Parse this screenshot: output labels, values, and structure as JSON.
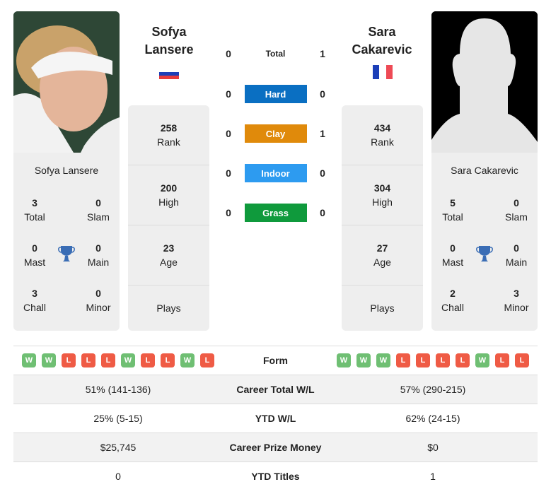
{
  "player1": {
    "name_line1": "Sofya",
    "name_line2": "Lansere",
    "full_name": "Sofya Lansere",
    "flag": "russia-flag",
    "titles": {
      "total": "3",
      "total_label": "Total",
      "slam": "0",
      "slam_label": "Slam",
      "mast": "0",
      "mast_label": "Mast",
      "main": "0",
      "main_label": "Main",
      "chall": "3",
      "chall_label": "Chall",
      "minor": "0",
      "minor_label": "Minor"
    },
    "stats": {
      "rank": "258",
      "rank_label": "Rank",
      "high": "200",
      "high_label": "High",
      "age": "23",
      "age_label": "Age",
      "plays_label": "Plays"
    },
    "form": [
      "W",
      "W",
      "L",
      "L",
      "L",
      "W",
      "L",
      "L",
      "W",
      "L"
    ],
    "career_wl": "51% (141-136)",
    "ytd_wl": "25% (5-15)",
    "prize_money": "$25,745",
    "ytd_titles": "0"
  },
  "player2": {
    "name_line1": "Sara",
    "name_line2": "Cakarevic",
    "full_name": "Sara Cakarevic",
    "flag": "france-flag",
    "titles": {
      "total": "5",
      "total_label": "Total",
      "slam": "0",
      "slam_label": "Slam",
      "mast": "0",
      "mast_label": "Mast",
      "main": "0",
      "main_label": "Main",
      "chall": "2",
      "chall_label": "Chall",
      "minor": "3",
      "minor_label": "Minor"
    },
    "stats": {
      "rank": "434",
      "rank_label": "Rank",
      "high": "304",
      "high_label": "High",
      "age": "27",
      "age_label": "Age",
      "plays_label": "Plays"
    },
    "form": [
      "W",
      "W",
      "W",
      "L",
      "L",
      "L",
      "L",
      "W",
      "L",
      "L"
    ],
    "career_wl": "57% (290-215)",
    "ytd_wl": "62% (24-15)",
    "prize_money": "$0",
    "ytd_titles": "1"
  },
  "h2h": {
    "total": {
      "label": "Total",
      "p1": "0",
      "p2": "1"
    },
    "surfaces": [
      {
        "label": "Hard",
        "p1": "0",
        "p2": "0",
        "color": "#0a6fc2"
      },
      {
        "label": "Clay",
        "p1": "0",
        "p2": "1",
        "color": "#e08a0b"
      },
      {
        "label": "Indoor",
        "p1": "0",
        "p2": "0",
        "color": "#2d9bf0"
      },
      {
        "label": "Grass",
        "p1": "0",
        "p2": "0",
        "color": "#0f9a3c"
      }
    ]
  },
  "table": {
    "form_label": "Form",
    "career_wl_label": "Career Total W/L",
    "ytd_wl_label": "YTD W/L",
    "prize_label": "Career Prize Money",
    "ytd_titles_label": "YTD Titles"
  },
  "colors": {
    "win": "#6fbf73",
    "loss": "#ef5b45",
    "trophy": "#3a6db5"
  }
}
